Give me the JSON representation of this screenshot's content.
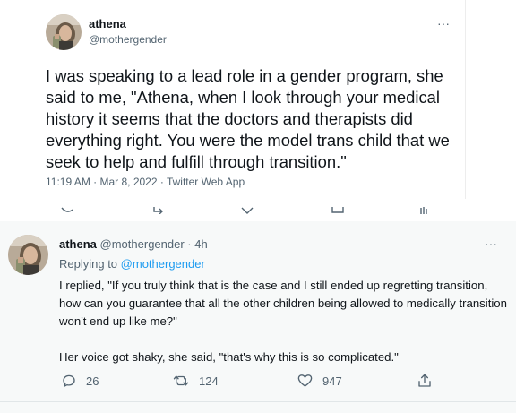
{
  "main_tweet": {
    "author_name": "athena",
    "author_handle": "@mothergender",
    "more_glyph": "···",
    "text": "I was speaking to a lead role in a gender program, she said to me, \"Athena, when I look through your medical history it seems that the doctors and therapists did everything right. You were the model trans child that we seek to help and fulfill through transition.\"",
    "meta": "11:19 AM · Mar 8, 2022 · Twitter Web App",
    "action_icons": [
      "reply-icon",
      "retweet-icon",
      "like-icon",
      "share-icon",
      "analytics-icon"
    ]
  },
  "reply_tweet": {
    "author_name": "athena",
    "author_handle": "@mothergender",
    "time_ago": "· 4h",
    "more_glyph": "···",
    "replying_prefix": "Replying to",
    "replying_handle": "@mothergender",
    "paragraph1": "I replied, \"If you truly think that is the case and I still ended up regretting transition, how can you guarantee that all the other children being allowed to medically transition won't end up like me?\"",
    "paragraph2": "Her voice got shaky, she said, \"that's why this is so complicated.\"",
    "actions": {
      "reply_count": "26",
      "retweet_count": "124",
      "like_count": "947"
    }
  },
  "colors": {
    "text": "#0f1419",
    "secondary": "#536471",
    "link": "#1d9bf0",
    "reply_background": "#f7f9f9"
  }
}
